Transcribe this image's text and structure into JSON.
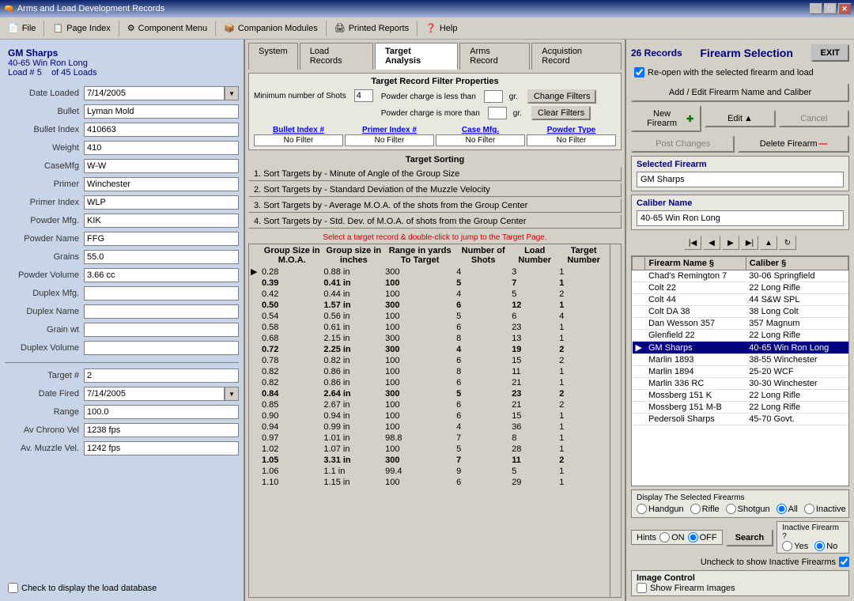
{
  "titleBar": {
    "title": "Arms and Load Development Records",
    "icon": "🔫"
  },
  "menuBar": {
    "items": [
      {
        "label": "File",
        "icon": "📄"
      },
      {
        "label": "Page Index",
        "icon": "📋"
      },
      {
        "label": "Component Menu",
        "icon": "⚙"
      },
      {
        "label": "Companion Modules",
        "icon": "📦"
      },
      {
        "label": "Printed Reports",
        "icon": "🖨"
      },
      {
        "label": "Help",
        "icon": "❓"
      }
    ]
  },
  "leftPanel": {
    "loadTitle": "GM Sharps",
    "loadSubtitle": "40-65 Win Ron Long",
    "loadNum": "Load #  5",
    "loadOf": "of  45  Loads",
    "fields": {
      "dateLoaded": "7/14/2005",
      "bullet": "Lyman Mold",
      "bulletIndex": "410663",
      "weight": "410",
      "caseMfg": "W-W",
      "primer": "Winchester",
      "primerIndex": "WLP",
      "powderMfg": "KIK",
      "powderName": "FFG",
      "grains": "55.0",
      "powderVolume": "3.66 cc",
      "duplexMfg": "",
      "duplexName": "",
      "grainWt": "",
      "duplexVolume": "",
      "targetNum": "2",
      "dateFired": "7/14/2005",
      "range": "100.0",
      "avChronoVel": "1238 fps",
      "avMuzzleVel": "1242 fps"
    },
    "labels": {
      "dateLoaded": "Date Loaded",
      "bullet": "Bullet",
      "bulletIndex": "Bullet Index",
      "weight": "Weight",
      "caseMfg": "CaseMfg",
      "primer": "Primer",
      "primerIndex": "Primer Index",
      "powderMfg": "Powder Mfg.",
      "powderName": "Powder Name",
      "grains": "Grains",
      "powderVolume": "Powder Volume",
      "duplexMfg": "Duplex Mfg.",
      "duplexName": "Duplex Name",
      "grainWt": "Grain wt",
      "duplexVolume": "Duplex Volume",
      "targetNum": "Target #",
      "dateFired": "Date Fired",
      "range": "Range",
      "avChronoVel": "Av Chrono Vel",
      "avMuzzleVel": "Av. Muzzle Vel."
    },
    "bottomLabel": "Check to display the load database"
  },
  "centerPanel": {
    "tabs": [
      {
        "label": "System",
        "active": false
      },
      {
        "label": "Load Records",
        "active": false
      },
      {
        "label": "Target Analysis",
        "active": true
      },
      {
        "label": "Arms Record",
        "active": false
      },
      {
        "label": "Acquistion Record",
        "active": false
      }
    ],
    "filterSection": {
      "title": "Target Record Filter Properties",
      "minShotsLabel": "Minimum number of Shots",
      "minShotsValue": "4",
      "powderLessLabel": "Powder charge is less than",
      "powderMoreLabel": "Powder charge is more than",
      "changeFiltersBtn": "Change Filters",
      "clearFiltersBtn": "Clear Filters",
      "grLabel": "gr.",
      "columns": [
        {
          "label": "Bullet Index #",
          "value": "No Filter"
        },
        {
          "label": "Primer Index #",
          "value": "No Filter"
        },
        {
          "label": "Case  Mfg.",
          "value": "No Filter"
        },
        {
          "label": "Powder Type",
          "value": "No Filter"
        }
      ]
    },
    "sortSection": {
      "title": "Target Sorting",
      "items": [
        "1.  Sort Targets by - Minute of Angle of the Group Size",
        "2.  Sort Targets by - Standard Deviation of the Muzzle Velocity",
        "3.  Sort Targets by - Average M.O.A. of the shots from the Group Center",
        "4.  Sort Targets by - Std. Dev. of M.O.A. of shots  from the Group Center"
      ]
    },
    "tableMsg": "Select a target record & double-click  to jump to the Target Page.",
    "tableHeaders": [
      {
        "label": "Group Size in M.O.A.",
        "width": "60"
      },
      {
        "label": "Group size in inches",
        "width": "60"
      },
      {
        "label": "Range in yards To Target",
        "width": "60"
      },
      {
        "label": "Number of Shots",
        "width": "40"
      },
      {
        "label": "Load Number",
        "width": "45"
      },
      {
        "label": "Target Number",
        "width": "45"
      }
    ],
    "tableRows": [
      {
        "arrow": "",
        "bold": false,
        "data": [
          "0.28",
          "0.88 in",
          "300",
          "4",
          "3",
          "1"
        ]
      },
      {
        "arrow": "",
        "bold": true,
        "data": [
          "0.39",
          "0.41 in",
          "100",
          "5",
          "7",
          "1"
        ]
      },
      {
        "arrow": "",
        "bold": false,
        "data": [
          "0.42",
          "0.44 in",
          "100",
          "4",
          "5",
          "2"
        ]
      },
      {
        "arrow": "",
        "bold": true,
        "data": [
          "0.50",
          "1.57 in",
          "300",
          "6",
          "12",
          "1"
        ]
      },
      {
        "arrow": "",
        "bold": false,
        "data": [
          "0.54",
          "0.56 in",
          "100",
          "5",
          "6",
          "4"
        ]
      },
      {
        "arrow": "",
        "bold": false,
        "data": [
          "0.58",
          "0.61 in",
          "100",
          "6",
          "23",
          "1"
        ]
      },
      {
        "arrow": "",
        "bold": false,
        "data": [
          "0.68",
          "2.15 in",
          "300",
          "8",
          "13",
          "1"
        ]
      },
      {
        "arrow": "",
        "bold": true,
        "data": [
          "0.72",
          "2.25 in",
          "300",
          "4",
          "19",
          "2"
        ]
      },
      {
        "arrow": "",
        "bold": false,
        "data": [
          "0.78",
          "0.82 in",
          "100",
          "6",
          "15",
          "2"
        ]
      },
      {
        "arrow": "",
        "bold": false,
        "data": [
          "0.82",
          "0.86 in",
          "100",
          "8",
          "11",
          "1"
        ]
      },
      {
        "arrow": "",
        "bold": false,
        "data": [
          "0.82",
          "0.86 in",
          "100",
          "6",
          "21",
          "1"
        ]
      },
      {
        "arrow": "",
        "bold": true,
        "data": [
          "0.84",
          "2.64 in",
          "300",
          "5",
          "23",
          "2"
        ]
      },
      {
        "arrow": "",
        "bold": false,
        "data": [
          "0.85",
          "2.67 in",
          "100",
          "6",
          "21",
          "2"
        ]
      },
      {
        "arrow": "",
        "bold": false,
        "data": [
          "0.90",
          "0.94 in",
          "100",
          "6",
          "15",
          "1"
        ]
      },
      {
        "arrow": "",
        "bold": false,
        "data": [
          "0.94",
          "0.99 in",
          "100",
          "4",
          "36",
          "1"
        ]
      },
      {
        "arrow": "",
        "bold": false,
        "data": [
          "0.97",
          "1.01 in",
          "98.8",
          "7",
          "8",
          "1"
        ]
      },
      {
        "arrow": "",
        "bold": false,
        "data": [
          "1.02",
          "1.07 in",
          "100",
          "5",
          "28",
          "1"
        ]
      },
      {
        "arrow": "",
        "bold": true,
        "data": [
          "1.05",
          "3.31 in",
          "300",
          "7",
          "11",
          "2"
        ]
      },
      {
        "arrow": "",
        "bold": false,
        "data": [
          "1.06",
          "1.1 in",
          "99.4",
          "9",
          "5",
          "1"
        ]
      },
      {
        "arrow": "",
        "bold": false,
        "data": [
          "1.10",
          "1.15 in",
          "100",
          "6",
          "29",
          "1"
        ]
      }
    ]
  },
  "rightPanel": {
    "recordsCount": "26 Records",
    "title": "Firearm Selection",
    "exitBtn": "EXIT",
    "reopenLabel": "Re-open with the selected firearm and load",
    "addEditBtn": "Add / Edit Firearm Name and Caliber",
    "newFirearmBtn": "New Firearm",
    "editBtn": "Edit",
    "cancelBtn": "Cancel",
    "postChangesBtn": "Post Changes",
    "deleteFirearmBtn": "Delete Firearm",
    "selectedFirearmLabel": "Selected Firearm",
    "selectedFirearm": "GM Sharps",
    "caliberNameLabel": "Caliber Name",
    "caliberName": "40-65 Win Ron Long",
    "firearmsListHeaders": [
      {
        "label": "Firearm Name §"
      },
      {
        "label": "Caliber  §"
      }
    ],
    "firearmsListRows": [
      {
        "name": "Chad's Remington 7",
        "caliber": "30-06 Springfield",
        "selected": false,
        "arrow": ""
      },
      {
        "name": "Colt 22",
        "caliber": "22 Long Rifle",
        "selected": false,
        "arrow": ""
      },
      {
        "name": "Colt 44",
        "caliber": "44 S&W SPL",
        "selected": false,
        "arrow": ""
      },
      {
        "name": "Colt DA 38",
        "caliber": "38 Long Colt",
        "selected": false,
        "arrow": ""
      },
      {
        "name": "Dan Wesson 357",
        "caliber": "357 Magnum",
        "selected": false,
        "arrow": ""
      },
      {
        "name": "Glenfield 22",
        "caliber": "22 Long Rifle",
        "selected": false,
        "arrow": ""
      },
      {
        "name": "GM Sharps",
        "caliber": "40-65 Win Ron Long",
        "selected": true,
        "arrow": "▶"
      },
      {
        "name": "Marlin 1893",
        "caliber": "38-55 Winchester",
        "selected": false,
        "arrow": ""
      },
      {
        "name": "Marlin 1894",
        "caliber": "25-20 WCF",
        "selected": false,
        "arrow": ""
      },
      {
        "name": "Marlin 336 RC",
        "caliber": "30-30 Winchester",
        "selected": false,
        "arrow": ""
      },
      {
        "name": "Mossberg 151 K",
        "caliber": "22 Long Rifle",
        "selected": false,
        "arrow": ""
      },
      {
        "name": "Mossberg 151 M-B",
        "caliber": "22 Long Rifle",
        "selected": false,
        "arrow": ""
      },
      {
        "name": "Pedersoli Sharps",
        "caliber": "45-70 Govt.",
        "selected": false,
        "arrow": ""
      }
    ],
    "displaySection": {
      "title": "Display The Selected Firearms",
      "options": [
        "Handgun",
        "Rifle",
        "Shotgun",
        "All",
        "Inactive"
      ],
      "selected": "All"
    },
    "hints": {
      "label": "Hints",
      "onLabel": "ON",
      "offLabel": "OFF",
      "selected": "OFF"
    },
    "searchBtn": "Search",
    "inactiveFirearm": {
      "label": "Inactive Firearm ?",
      "yesLabel": "Yes",
      "noLabel": "No",
      "selected": "No"
    },
    "uncheckLabel": "Uncheck to show Inactive Firearms",
    "imageControl": {
      "title": "Image Control",
      "showLabel": "Show Firearm Images"
    }
  }
}
